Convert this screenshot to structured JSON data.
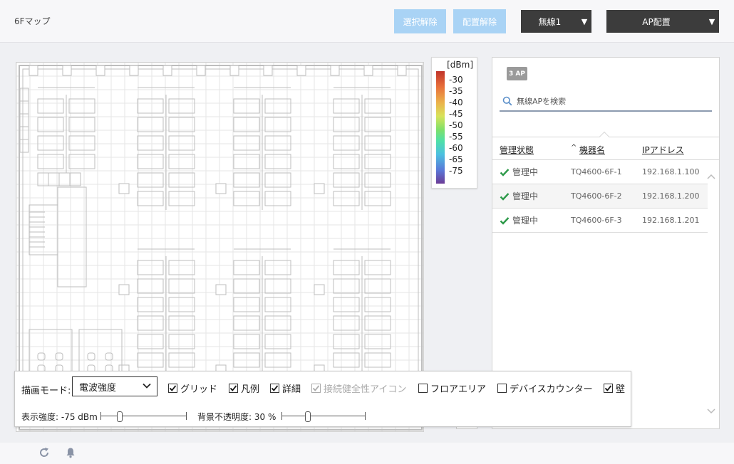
{
  "header": {
    "title": "6Fマップ",
    "deselect_label": "選択解除",
    "unplace_label": "配置解除",
    "wireless_label": "無線1",
    "ap_place_label": "AP配置"
  },
  "legend": {
    "unit": "[dBm]",
    "ticks": [
      "-30",
      "-35",
      "-40",
      "-45",
      "-50",
      "-55",
      "-60",
      "-65",
      "-75"
    ]
  },
  "panel": {
    "ap_count": "3 AP",
    "search_placeholder": "無線APを検索",
    "columns": {
      "status": "管理状態",
      "sort_indicator": "^",
      "name": "機器名",
      "ip": "IPアドレス"
    },
    "rows": [
      {
        "status": "管理中",
        "name": "TQ4600-6F-1",
        "ip": "192.168.1.100"
      },
      {
        "status": "管理中",
        "name": "TQ4600-6F-2",
        "ip": "192.168.1.200"
      },
      {
        "status": "管理中",
        "name": "TQ4600-6F-3",
        "ip": "192.168.1.201"
      }
    ]
  },
  "controls": {
    "mode_label": "描画モード:",
    "mode_value": "電波強度",
    "checkboxes": [
      {
        "label": "グリッド",
        "checked": true,
        "disabled": false
      },
      {
        "label": "凡例",
        "checked": true,
        "disabled": false
      },
      {
        "label": "詳細",
        "checked": true,
        "disabled": false
      },
      {
        "label": "接続健全性アイコン",
        "checked": true,
        "disabled": true
      },
      {
        "label": "フロアエリア",
        "checked": false,
        "disabled": false
      },
      {
        "label": "デバイスカウンター",
        "checked": false,
        "disabled": false
      },
      {
        "label": "壁",
        "checked": true,
        "disabled": false
      }
    ],
    "strength_label": "表示強度: -75 dBm",
    "strength_value": 0.2,
    "opacity_label": "背景不透明度: 30 %",
    "opacity_value": 0.3
  },
  "colors": {
    "accent_light": "#a9d3f5",
    "dark_button": "#3c3c3c",
    "check_green": "#2e9a4a",
    "search_icon": "#5b8fc9"
  }
}
